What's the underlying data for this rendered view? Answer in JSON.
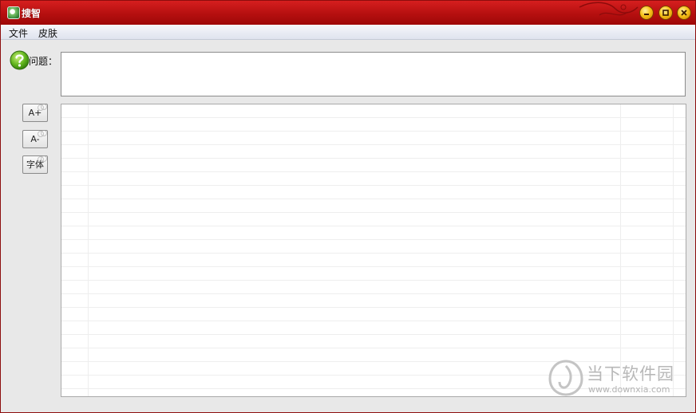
{
  "window": {
    "title": "搜智",
    "colors": {
      "titlebar": "#b50f0f",
      "window_buttons": "#f7c21a"
    }
  },
  "menu": {
    "items": [
      {
        "label": "文件"
      },
      {
        "label": "皮肤"
      }
    ]
  },
  "question": {
    "label": "问题：",
    "value": "",
    "icon": "help-icon"
  },
  "toolbar": {
    "increase_font_label": "A+",
    "decrease_font_label": "A-",
    "font_label": "字体"
  },
  "answer": {
    "value": ""
  },
  "watermark": {
    "name": "当下软件园",
    "url": "www.downxia.com"
  }
}
